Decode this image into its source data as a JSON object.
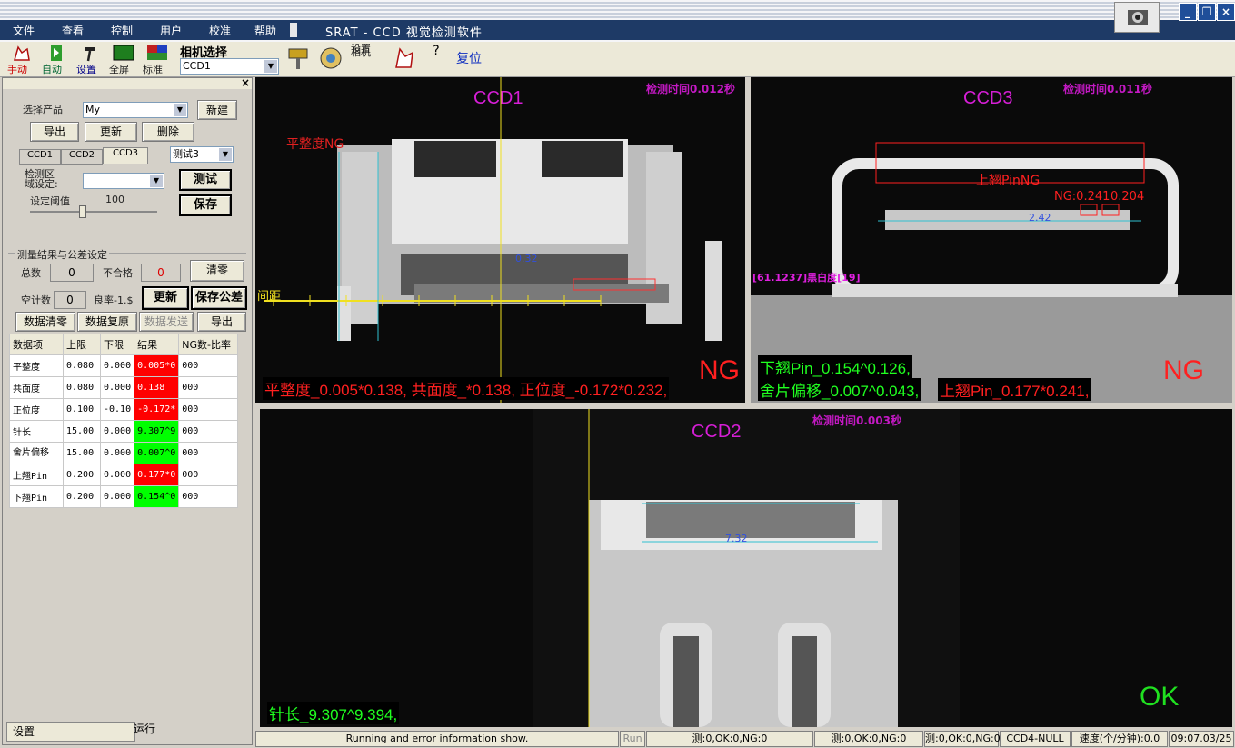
{
  "menu": [
    "文件",
    "查看",
    "控制",
    "用户",
    "校准",
    "帮助"
  ],
  "app_title": "SRAT - CCD 视觉检测软件",
  "window_buttons": [
    "minimize-icon",
    "restore-icon",
    "close-icon"
  ],
  "toolbar": {
    "manual": "手动",
    "auto": "自动",
    "settings": "设置",
    "fullscreen": "全屏",
    "calibrate": "标准",
    "camera_select_label": "相机选择",
    "camera_select_value": "CCD1",
    "camera_settings_line1": "相机",
    "camera_settings_line2": "设置",
    "reset": "复位"
  },
  "left": {
    "select_product_label": "选择产品",
    "product_value": "My",
    "new_btn": "新建",
    "export_btn": "导出",
    "update_btn": "更新",
    "delete_btn": "删除",
    "ccd_tabs": [
      "CCD1",
      "CCD2",
      "CCD3"
    ],
    "test_combo": "测试3",
    "detect_area_line1": "检测区",
    "detect_area_line2": "域设定:",
    "test_btn": "测试",
    "threshold_label": "设定阈值",
    "threshold_value": "100",
    "save_btn": "保存",
    "measure_group": "测量结果与公差设定",
    "total_label": "总数",
    "total_value": "0",
    "fail_label": "不合格",
    "fail_value": "0",
    "clear_btn": "清零",
    "empty_count_label": "空计数",
    "empty_count_value": "0",
    "yield_label": "良率-1.$",
    "refresh_btn": "更新",
    "save_tol_btn": "保存公差",
    "data_clear_btn": "数据清零",
    "data_restore_btn": "数据复原",
    "data_send_btn": "数据发送",
    "data_export_btn": "导出",
    "bottom_tabs": [
      "设置",
      "运行"
    ]
  },
  "table": {
    "headers": [
      "数据项",
      "上限",
      "下限",
      "结果",
      "NG数-比率"
    ],
    "rows": [
      {
        "item": "平整度",
        "upper": "0.080",
        "lower": "0.000",
        "result": "0.005*0",
        "ng": "000",
        "status": "red"
      },
      {
        "item": "共面度",
        "upper": "0.080",
        "lower": "0.000",
        "result": "0.138",
        "ng": "000",
        "status": "red"
      },
      {
        "item": "正位度",
        "upper": "0.100",
        "lower": "-0.10",
        "result": "-0.172*",
        "ng": "000",
        "status": "red"
      },
      {
        "item": "针长",
        "upper": "15.00",
        "lower": "0.000",
        "result": "9.307^9",
        "ng": "000",
        "status": "green"
      },
      {
        "item": "舍片偏移",
        "upper": "15.00",
        "lower": "0.000",
        "result": "0.007^0",
        "ng": "000",
        "status": "green"
      },
      {
        "item": "上翘Pin",
        "upper": "0.200",
        "lower": "0.000",
        "result": "0.177*0",
        "ng": "000",
        "status": "red"
      },
      {
        "item": "下翘Pin",
        "upper": "0.200",
        "lower": "0.000",
        "result": "0.154^0",
        "ng": "000",
        "status": "green"
      }
    ]
  },
  "views": {
    "ccd1": {
      "title": "CCD1",
      "timing": "检测时间0.012秒",
      "verdict": "NG",
      "flatness_ng": "平整度NG",
      "spacing": "间距",
      "center_val": "0.32",
      "summary": "平整度_0.005*0.138, 共面度_*0.138, 正位度_-0.172*0.232,"
    },
    "ccd3": {
      "title": "CCD3",
      "timing": "检测时间0.011秒",
      "verdict": "NG",
      "warp_ng": "上翘PinNG",
      "ng_value": "NG:0.241",
      "ng_value2": "0.204",
      "center_val": "2.42",
      "blackwhite": "[61.1237]黑白度[19]",
      "line1a": "下翘Pin_0.154^0.126,",
      "line2a": "舍片偏移_0.007^0.043,",
      "line2b": "上翘Pin_0.177*0.241,"
    },
    "ccd2": {
      "title": "CCD2",
      "timing": "检测时间0.003秒",
      "verdict": "OK",
      "center_val": "7.32",
      "summary": "针长_9.307^9.394,"
    }
  },
  "status": {
    "info": "Running and error information show.",
    "run": "Run",
    "cnt1": "测:0,OK:0,NG:0",
    "cnt2": "测:0,OK:0,NG:0",
    "cnt3": "测:0,OK:0,NG:0",
    "ccd4": "CCD4-NULL",
    "speed": "速度(个/分钟):0.0",
    "time": "09:07.03/25"
  },
  "colors": {
    "ng": "#ff0000",
    "ok": "#00e000",
    "title": "#d61ed6",
    "menu": "#1e3a66"
  }
}
